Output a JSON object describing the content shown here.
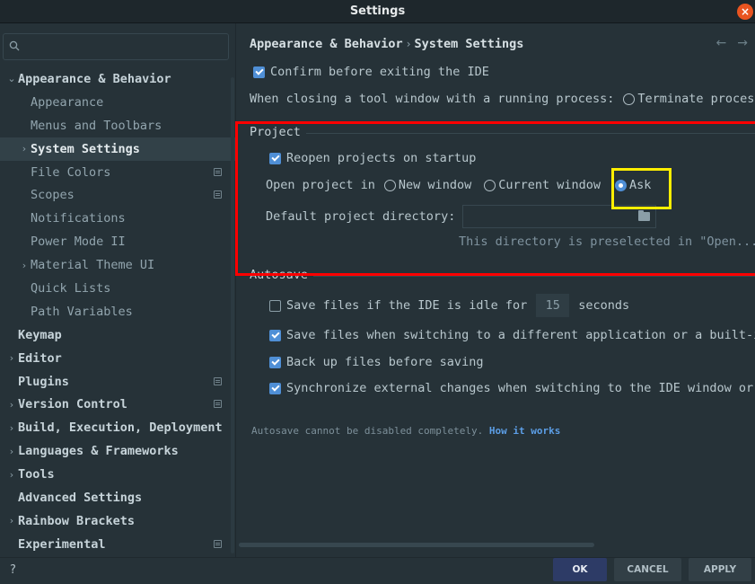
{
  "window": {
    "title": "Settings",
    "close_icon": "×"
  },
  "search": {
    "placeholder": "Q·"
  },
  "sidebar": {
    "items": [
      {
        "label": "Appearance & Behavior",
        "arrow": "⌄",
        "level": "top"
      },
      {
        "label": "Appearance",
        "arrow": "",
        "level": "child"
      },
      {
        "label": "Menus and Toolbars",
        "arrow": "",
        "level": "child"
      },
      {
        "label": "System Settings",
        "arrow": "›",
        "level": "child",
        "selected": true
      },
      {
        "label": "File Colors",
        "arrow": "",
        "level": "child",
        "badge": true
      },
      {
        "label": "Scopes",
        "arrow": "",
        "level": "child",
        "badge": true
      },
      {
        "label": "Notifications",
        "arrow": "",
        "level": "child"
      },
      {
        "label": "Power Mode II",
        "arrow": "",
        "level": "child"
      },
      {
        "label": "Material Theme UI",
        "arrow": "›",
        "level": "child"
      },
      {
        "label": "Quick Lists",
        "arrow": "",
        "level": "child"
      },
      {
        "label": "Path Variables",
        "arrow": "",
        "level": "child"
      },
      {
        "label": "Keymap",
        "arrow": "",
        "level": "top"
      },
      {
        "label": "Editor",
        "arrow": "›",
        "level": "top"
      },
      {
        "label": "Plugins",
        "arrow": "",
        "level": "top",
        "badge": true
      },
      {
        "label": "Version Control",
        "arrow": "›",
        "level": "top",
        "badge": true
      },
      {
        "label": "Build, Execution, Deployment",
        "arrow": "›",
        "level": "top"
      },
      {
        "label": "Languages & Frameworks",
        "arrow": "›",
        "level": "top"
      },
      {
        "label": "Tools",
        "arrow": "›",
        "level": "top"
      },
      {
        "label": "Advanced Settings",
        "arrow": "",
        "level": "top"
      },
      {
        "label": "Rainbow Brackets",
        "arrow": "›",
        "level": "top"
      },
      {
        "label": "Experimental",
        "arrow": "",
        "level": "top",
        "badge": true
      }
    ]
  },
  "breadcrumb": {
    "parent": "Appearance & Behavior",
    "sep": "›",
    "current": "System Settings"
  },
  "nav": {
    "back": "←",
    "forward": "→"
  },
  "general": {
    "confirm_exit": "Confirm before exiting the IDE",
    "closing_tool_window": "When closing a tool window with a running process:",
    "terminate_process": "Terminate process"
  },
  "project": {
    "title": "Project",
    "reopen": "Reopen projects on startup",
    "open_project_in": "Open project in",
    "new_window": "New window",
    "current_window": "Current window",
    "ask": "Ask",
    "default_dir_label": "Default project directory:",
    "default_dir_value": "",
    "hint": "This directory is preselected in \"Open..."
  },
  "autosave": {
    "title": "Autosave",
    "idle_prefix": "Save files if the IDE is idle for",
    "idle_seconds": "15",
    "idle_suffix": "seconds",
    "switching": "Save files when switching to a different application or a built-i",
    "backup": "Back up files before saving",
    "sync": "Synchronize external changes when switching to the IDE window or",
    "note": "Autosave cannot be disabled completely.",
    "note_link": "How it works"
  },
  "footer": {
    "help": "?",
    "ok": "OK",
    "cancel": "CANCEL",
    "apply": "APPLY"
  },
  "colors": {
    "accent": "#4f8fd6",
    "highlight_red": "#ff0000",
    "highlight_yellow": "#ffee00",
    "ok_button": "#2d3b66"
  }
}
